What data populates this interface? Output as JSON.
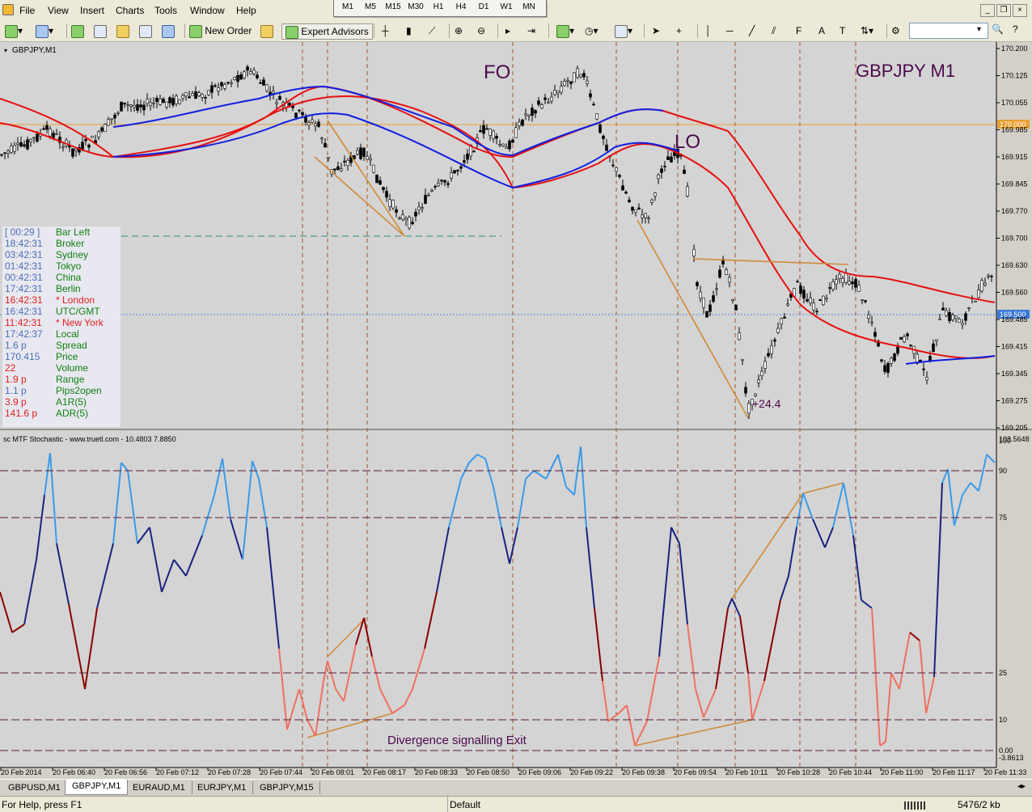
{
  "menu": [
    "File",
    "View",
    "Insert",
    "Charts",
    "Tools",
    "Window",
    "Help"
  ],
  "timeframes": [
    "M1",
    "M5",
    "M15",
    "M30",
    "H1",
    "H4",
    "D1",
    "W1",
    "MN"
  ],
  "toolbar": {
    "new_order": "New Order",
    "expert_advisors": "Expert Advisors",
    "text_tool": "A"
  },
  "chart": {
    "symbol_label": "GBPJPY,M1",
    "title_big": "GBPJPY M1",
    "label_fo": "FO",
    "label_lo": "LO",
    "label_pips": "+24.4",
    "price_axis": [
      "170.200",
      "170.125",
      "170.055",
      "169.985",
      "169.915",
      "169.845",
      "169.770",
      "169.700",
      "169.630",
      "169.560",
      "169.485",
      "169.415",
      "169.345",
      "169.275",
      "169.205"
    ],
    "price_hline_orange": "170.000",
    "price_hline_blue": "169.500",
    "indicator_label": "sc MTF Stochastic - www.truetl.com - 10.4803 7.8850",
    "indicator_axis": [
      "103.5648",
      "100",
      "90",
      "75",
      "25",
      "10",
      "0.00",
      "-3.8613"
    ],
    "divergence_text": "Divergence signalling Exit",
    "time_axis": [
      "20 Feb 2014",
      "20 Feb 06:40",
      "20 Feb 06:56",
      "20 Feb 07:12",
      "20 Feb 07:28",
      "20 Feb 07:44",
      "20 Feb 08:01",
      "20 Feb 08:17",
      "20 Feb 08:33",
      "20 Feb 08:50",
      "20 Feb 09:06",
      "20 Feb 09:22",
      "20 Feb 09:38",
      "20 Feb 09:54",
      "20 Feb 10:11",
      "20 Feb 10:28",
      "20 Feb 10:44",
      "20 Feb 11:00",
      "20 Feb 11:17",
      "20 Feb 11:33"
    ],
    "colors": {
      "bg": "#d4d4d4",
      "ma_red": "#e81010",
      "ma_blue": "#1020e0",
      "candle": "#000000",
      "trend": "#d08a3a",
      "stoch_light": "#3b9ae8",
      "stoch_dark": "#1a237e",
      "stoch_dk_red": "#8b0000",
      "stoch_salmon": "#f07060"
    }
  },
  "info_panel": [
    {
      "t": "[ 00:29 ]",
      "l": "Bar Left",
      "tc": "#4a6fb8",
      "lc": "#108010"
    },
    {
      "t": "18:42:31",
      "l": "Broker",
      "tc": "#4a6fb8",
      "lc": "#108010"
    },
    {
      "t": "03:42:31",
      "l": "Sydney",
      "tc": "#4a6fb8",
      "lc": "#108010"
    },
    {
      "t": "01:42:31",
      "l": "Tokyo",
      "tc": "#4a6fb8",
      "lc": "#108010"
    },
    {
      "t": "00:42:31",
      "l": "China",
      "tc": "#4a6fb8",
      "lc": "#108010"
    },
    {
      "t": "17:42:31",
      "l": "Berlin",
      "tc": "#4a6fb8",
      "lc": "#108010"
    },
    {
      "t": "16:42:31",
      "l": "* London",
      "tc": "#e02020",
      "lc": "#e02020"
    },
    {
      "t": "16:42:31",
      "l": "UTC/GMT",
      "tc": "#4a6fb8",
      "lc": "#108010"
    },
    {
      "t": "11:42:31",
      "l": "* New York",
      "tc": "#e02020",
      "lc": "#e02020"
    },
    {
      "t": "17:42:37",
      "l": "Local",
      "tc": "#4a6fb8",
      "lc": "#108010"
    },
    {
      "t": "1.6 p",
      "l": "Spread",
      "tc": "#4a6fb8",
      "lc": "#108010"
    },
    {
      "t": "170.415",
      "l": "Price",
      "tc": "#4a6fb8",
      "lc": "#108010"
    },
    {
      "t": "22",
      "l": "Volume",
      "tc": "#e02020",
      "lc": "#108010"
    },
    {
      "t": "1.9 p",
      "l": "Range",
      "tc": "#e02020",
      "lc": "#108010"
    },
    {
      "t": "1.1 p",
      "l": "Pips2open",
      "tc": "#4a6fb8",
      "lc": "#108010"
    },
    {
      "t": "3.9 p",
      "l": "A1R(5)",
      "tc": "#e02020",
      "lc": "#108010"
    },
    {
      "t": "141.6 p",
      "l": "ADR(5)",
      "tc": "#e02020",
      "lc": "#108010"
    }
  ],
  "tabs": [
    "GBPUSD,M1",
    "GBPJPY,M1",
    "EURAUD,M1",
    "EURJPY,M1",
    "GBPJPY,M15"
  ],
  "status": {
    "help": "For Help, press F1",
    "profile": "Default",
    "traffic": "5476/2 kb"
  }
}
